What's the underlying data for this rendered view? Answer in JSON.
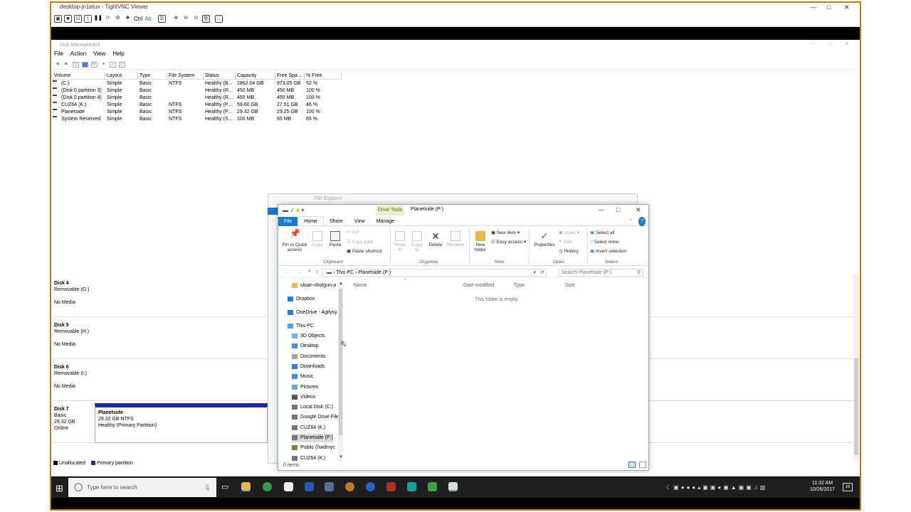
{
  "vnc": {
    "title": "desktop-jn1etuv - TightVNC Viewer",
    "ctrl": "Ctrl",
    "alt": "Alt"
  },
  "disk_mgmt": {
    "title": "Disk Management",
    "menu": [
      "File",
      "Action",
      "View",
      "Help"
    ],
    "columns": [
      "Volume",
      "Layout",
      "Type",
      "File System",
      "Status",
      "Capacity",
      "Free Spa...",
      "% Free"
    ],
    "volumes": [
      [
        "(C:)",
        "Simple",
        "Basic",
        "NTFS",
        "Healthy (B...",
        "1862.04 GB",
        "973.05 GB",
        "52 %"
      ],
      [
        "(Disk 0 partition 3)",
        "Simple",
        "Basic",
        "",
        "Healthy (R...",
        "450 MB",
        "450 MB",
        "100 %"
      ],
      [
        "(Disk 0 partition 4)",
        "Simple",
        "Basic",
        "",
        "Healthy (R...",
        "450 MB",
        "450 MB",
        "100 %"
      ],
      [
        "CUZ64 (K:)",
        "Simple",
        "Basic",
        "NTFS",
        "Healthy (P...",
        "59.60 GB",
        "27.51 GB",
        "46 %"
      ],
      [
        "Planetside",
        "Simple",
        "Basic",
        "NTFS",
        "Healthy (P...",
        "29.32 GB",
        "29.25 GB",
        "100 %"
      ],
      [
        "System Reserved",
        "Simple",
        "Basic",
        "NTFS",
        "Healthy (S...",
        "100 MB",
        "65 MB",
        "65 %"
      ]
    ],
    "disks": [
      {
        "name": "Disk 4",
        "type": "Removable (G:)",
        "media": "No Media"
      },
      {
        "name": "Disk 5",
        "type": "Removable (H:)",
        "media": "No Media"
      },
      {
        "name": "Disk 6",
        "type": "Removable (I:)",
        "media": "No Media"
      }
    ],
    "disk7": {
      "name": "Disk 7",
      "kind": "Basic",
      "size": "29.32 GB",
      "state": "Online",
      "partition": {
        "name": "Planetside",
        "size": "29.32 GB NTFS",
        "status": "Healthy (Primary Partition)"
      }
    },
    "legend": [
      {
        "label": "Unallocated",
        "color": "#111111"
      },
      {
        "label": "Primary partition",
        "color": "#1a2a9c"
      }
    ]
  },
  "bg_explorer": {
    "title": "File Explorer"
  },
  "explorer": {
    "title": "Planetside (P:)",
    "drive_tools": "Drive Tools",
    "tabs": [
      "File",
      "Home",
      "Share",
      "View",
      "Manage"
    ],
    "ribbon": {
      "pin": "Pin to Quick access",
      "copy": "Copy",
      "paste": "Paste",
      "cut": "Cut",
      "copy_path": "Copy path",
      "paste_shortcut": "Paste shortcut",
      "move_to": "Move to",
      "copy_to": "Copy to",
      "delete": "Delete",
      "rename": "Rename",
      "new_folder": "New folder",
      "new_item": "New item",
      "easy_access": "Easy access",
      "properties": "Properties",
      "open": "Open",
      "edit": "Edit",
      "history": "History",
      "select_all": "Select all",
      "select_none": "Select none",
      "invert_selection": "Invert selection",
      "groups": [
        "Clipboard",
        "Organize",
        "New",
        "Open",
        "Select"
      ]
    },
    "address": {
      "root": "This PC",
      "current": "Planetside (P:)"
    },
    "search_placeholder": "Search Planetside (P:)",
    "nav": [
      {
        "label": "sloan-shotgun-a",
        "icon": "folder-icon",
        "color": "#e8b84a"
      },
      {
        "label": "Dropbox",
        "icon": "dropbox-icon",
        "color": "#2b7de0"
      },
      {
        "label": "OneDrive - Agilysy",
        "icon": "onedrive-icon",
        "color": "#2b7de0"
      },
      {
        "label": "This PC",
        "icon": "pc-icon",
        "color": "#5aa0d8"
      },
      {
        "label": "3D Objects",
        "icon": "cube-icon",
        "color": "#6fb3e8"
      },
      {
        "label": "Desktop",
        "icon": "desktop-icon",
        "color": "#3d8fd6"
      },
      {
        "label": "Documents",
        "icon": "documents-icon",
        "color": "#9aa4b0"
      },
      {
        "label": "Downloads",
        "icon": "download-icon",
        "color": "#2b7de0"
      },
      {
        "label": "Music",
        "icon": "music-icon",
        "color": "#3d8fd6"
      },
      {
        "label": "Pictures",
        "icon": "pictures-icon",
        "color": "#6aa6d6"
      },
      {
        "label": "Videos",
        "icon": "videos-icon",
        "color": "#555555"
      },
      {
        "label": "Local Disk (C:)",
        "icon": "drive-icon",
        "color": "#777777"
      },
      {
        "label": "Google Drive File",
        "icon": "drive-icon",
        "color": "#777777"
      },
      {
        "label": "CUZ64 (K:)",
        "icon": "drive-icon",
        "color": "#777777"
      },
      {
        "label": "Planetside (P:)",
        "icon": "drive-icon",
        "color": "#777777"
      },
      {
        "label": "Public (\\\\wdmyc",
        "icon": "network-drive-icon",
        "color": "#6a8a3a"
      },
      {
        "label": "CUZ64 (K:)",
        "icon": "drive-icon",
        "color": "#777777"
      }
    ],
    "columns": [
      "Name",
      "Date modified",
      "Type",
      "Size"
    ],
    "empty": "This folder is empty.",
    "status": "0 items"
  },
  "taskbar": {
    "search_placeholder": "Type here to search",
    "time": "11:32 AM",
    "date": "10/26/2017",
    "notifications": "16"
  }
}
